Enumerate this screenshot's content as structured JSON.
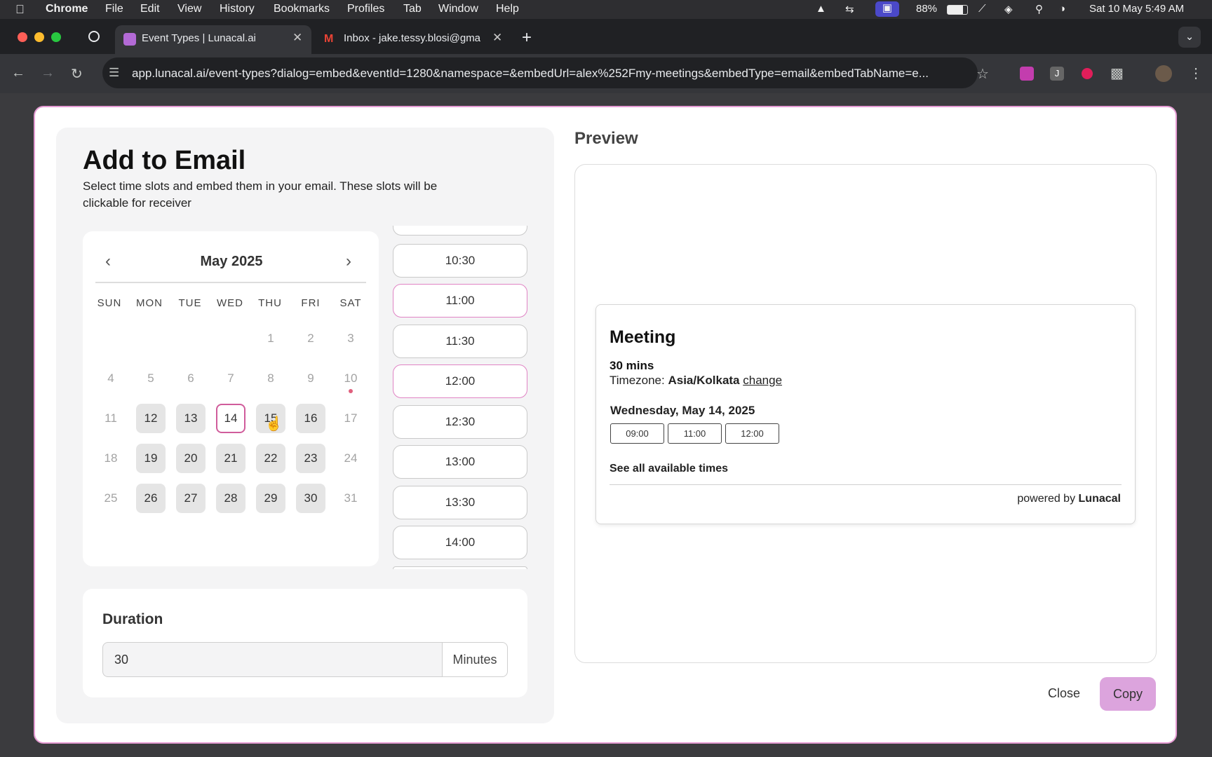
{
  "menubar": {
    "app": "Chrome",
    "items": [
      "File",
      "Edit",
      "View",
      "History",
      "Bookmarks",
      "Profiles",
      "Tab",
      "Window",
      "Help"
    ],
    "battery": "88%",
    "datetime": "Sat 10 May  5:49 AM"
  },
  "tabs": [
    {
      "title": "Event Types | Lunacal.ai"
    },
    {
      "title": "Inbox - jake.tessy.blosi@gmai"
    }
  ],
  "address_bar": {
    "url": "app.lunacal.ai/event-types?dialog=embed&eventId=1280&namespace=&embedUrl=alex%252Fmy-meetings&embedType=email&embedTabName=e..."
  },
  "dialog": {
    "title": "Add to Email",
    "subtitle": "Select time slots and embed them in your email. These slots will be clickable for receiver",
    "calendar": {
      "month": "May 2025",
      "weekdays": [
        "SUN",
        "MON",
        "TUE",
        "WED",
        "THU",
        "FRI",
        "SAT"
      ],
      "rows": [
        [
          "",
          "",
          "",
          "",
          "1",
          "2",
          "3"
        ],
        [
          "4",
          "5",
          "6",
          "7",
          "8",
          "9",
          "10"
        ],
        [
          "11",
          "12",
          "13",
          "14",
          "15",
          "16",
          "17"
        ],
        [
          "18",
          "19",
          "20",
          "21",
          "22",
          "23",
          "24"
        ],
        [
          "25",
          "26",
          "27",
          "28",
          "29",
          "30",
          "31"
        ]
      ],
      "selected_day": "14"
    },
    "time_slots": [
      "10:30",
      "11:00",
      "11:30",
      "12:00",
      "12:30",
      "13:00",
      "13:30",
      "14:00"
    ],
    "selected_slots": [
      "11:00",
      "12:00"
    ],
    "duration": {
      "label": "Duration",
      "value": "30",
      "unit": "Minutes"
    },
    "preview": {
      "label": "Preview",
      "meeting_title": "Meeting",
      "meeting_duration": "30 mins",
      "timezone_label": "Timezone:",
      "timezone_value": "Asia/Kolkata",
      "timezone_change": "change",
      "date": "Wednesday, May 14, 2025",
      "slots": [
        "09:00",
        "11:00",
        "12:00"
      ],
      "see_all": "See all available times",
      "powered_prefix": "powered by",
      "powered_brand": "Lunacal"
    },
    "buttons": {
      "close": "Close",
      "copy": "Copy"
    }
  }
}
